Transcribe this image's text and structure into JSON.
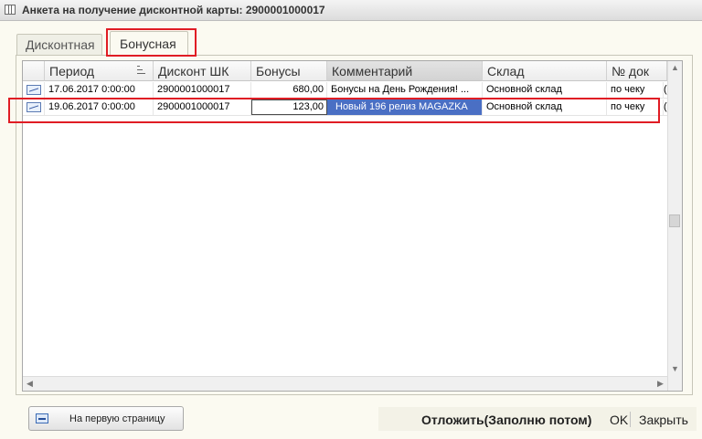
{
  "window": {
    "title": "Анкета на получение дисконтной карты: 2900001000017"
  },
  "tabs": [
    {
      "label": "Дисконтная",
      "active": false
    },
    {
      "label": "Бонусная",
      "active": true
    }
  ],
  "table": {
    "columns": [
      "Период",
      "Дисконт ШК",
      "Бонусы",
      "Комментарий",
      "Склад",
      "№ док"
    ],
    "sorted_column": "Период",
    "rows": [
      {
        "period": "17.06.2017 0:00:00",
        "discount": "2900001000017",
        "bonus": "680,00",
        "comment": "Бонусы на День Рождения! ...",
        "warehouse": "Основной склад",
        "doc": "по чеку",
        "extra": "("
      },
      {
        "period": "19.06.2017 0:00:00",
        "discount": "2900001000017",
        "bonus": "123,00",
        "comment": "Новый 196 релиз MAGAZKA",
        "warehouse": "Основной склад",
        "doc": "по чеку",
        "extra": "("
      }
    ],
    "selected_row": 1
  },
  "footer": {
    "first_page_label": "На первую страницу",
    "postpone_label": "Отложить(Заполню потом)",
    "ok_label": "OK",
    "close_label": "Закрыть"
  },
  "colors": {
    "highlight": "#e01c24",
    "selection": "#4a6fc4",
    "background": "#fbfaf1"
  }
}
